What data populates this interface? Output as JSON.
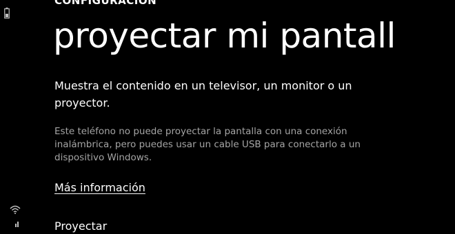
{
  "header": {
    "section": "CONFIGURACIÓN",
    "title": "proyectar mi pantall"
  },
  "main": {
    "description": "Muestra el contenido en un televisor, un monitor o un proyector.",
    "note": "Este teléfono no puede proyectar la pantalla con una conexión inalámbrica, pero puedes usar un cable USB para conectarlo a un dispositivo Windows.",
    "more_info_link": "Más información",
    "bottom_item": "Proyectar"
  },
  "status_bar": {
    "icons": [
      "battery-icon",
      "wifi-icon",
      "signal-icon"
    ]
  },
  "colors": {
    "background": "#000000",
    "text": "#ffffff",
    "secondary_text": "#a5a5a5"
  }
}
